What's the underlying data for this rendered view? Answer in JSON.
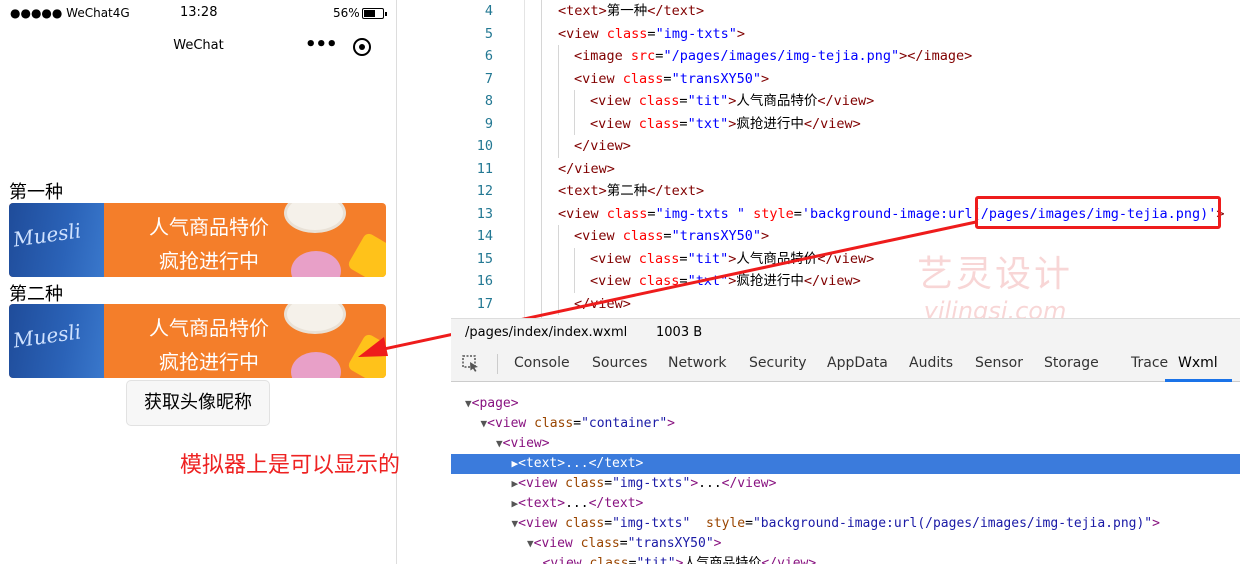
{
  "status_bar": {
    "signal": "●●●●● WeChat4G",
    "time": "13:28",
    "battery": "56%"
  },
  "navbar": {
    "title": "WeChat",
    "menu_dots": "•••"
  },
  "content": {
    "item1": {
      "label": "第一种",
      "tit": "人气商品特价",
      "txt": "疯抢进行中"
    },
    "item2": {
      "label": "第二种",
      "tit": "人气商品特价",
      "txt": "疯抢进行中"
    },
    "button_label": "获取头像昵称"
  },
  "annotation": "模拟器上是可以显示的",
  "editor": {
    "lines": [
      {
        "num": "4",
        "indent": 0,
        "parts": [
          [
            "tag",
            "<text>"
          ],
          [
            "txt",
            "第一种"
          ],
          [
            "tag",
            "</text>"
          ]
        ]
      },
      {
        "num": "5",
        "indent": 0,
        "parts": [
          [
            "tag",
            "<view "
          ],
          [
            "attr",
            "class"
          ],
          [
            "txt",
            "="
          ],
          [
            "val",
            "\"img-txts\""
          ],
          [
            "tag",
            ">"
          ]
        ]
      },
      {
        "num": "6",
        "indent": 1,
        "parts": [
          [
            "tag",
            "<image "
          ],
          [
            "attr",
            "src"
          ],
          [
            "txt",
            "="
          ],
          [
            "val",
            "\"/pages/images/img-tejia.png\""
          ],
          [
            "tag",
            "></image>"
          ]
        ]
      },
      {
        "num": "7",
        "indent": 1,
        "parts": [
          [
            "tag",
            "<view "
          ],
          [
            "attr",
            "class"
          ],
          [
            "txt",
            "="
          ],
          [
            "val",
            "\"transXY50\""
          ],
          [
            "tag",
            ">"
          ]
        ]
      },
      {
        "num": "8",
        "indent": 2,
        "parts": [
          [
            "tag",
            "<view "
          ],
          [
            "attr",
            "class"
          ],
          [
            "txt",
            "="
          ],
          [
            "val",
            "\"tit\""
          ],
          [
            "tag",
            ">"
          ],
          [
            "txt",
            "人气商品特价"
          ],
          [
            "tag",
            "</view>"
          ]
        ]
      },
      {
        "num": "9",
        "indent": 2,
        "parts": [
          [
            "tag",
            "<view "
          ],
          [
            "attr",
            "class"
          ],
          [
            "txt",
            "="
          ],
          [
            "val",
            "\"txt\""
          ],
          [
            "tag",
            ">"
          ],
          [
            "txt",
            "疯抢进行中"
          ],
          [
            "tag",
            "</view>"
          ]
        ]
      },
      {
        "num": "10",
        "indent": 1,
        "parts": [
          [
            "tag",
            "</view>"
          ]
        ]
      },
      {
        "num": "11",
        "indent": 0,
        "parts": [
          [
            "tag",
            "</view>"
          ]
        ]
      },
      {
        "num": "12",
        "indent": 0,
        "parts": [
          [
            "tag",
            "<text>"
          ],
          [
            "txt",
            "第二种"
          ],
          [
            "tag",
            "</text>"
          ]
        ]
      },
      {
        "num": "13",
        "indent": 0,
        "parts": [
          [
            "tag",
            "<view "
          ],
          [
            "attr",
            "class"
          ],
          [
            "txt",
            "="
          ],
          [
            "val",
            "\"img-txts \""
          ],
          [
            "attr",
            " style"
          ],
          [
            "txt",
            "="
          ],
          [
            "val",
            "'background-image:url(/pages/images/img-tejia.png)'"
          ],
          [
            "tag",
            ">"
          ]
        ]
      },
      {
        "num": "14",
        "indent": 1,
        "parts": [
          [
            "tag",
            "<view "
          ],
          [
            "attr",
            "class"
          ],
          [
            "txt",
            "="
          ],
          [
            "val",
            "\"transXY50\""
          ],
          [
            "tag",
            ">"
          ]
        ]
      },
      {
        "num": "15",
        "indent": 2,
        "parts": [
          [
            "tag",
            "<view "
          ],
          [
            "attr",
            "class"
          ],
          [
            "txt",
            "="
          ],
          [
            "val",
            "\"tit\""
          ],
          [
            "tag",
            ">"
          ],
          [
            "txt",
            "人气商品特价"
          ],
          [
            "tag",
            "</view>"
          ]
        ]
      },
      {
        "num": "16",
        "indent": 2,
        "parts": [
          [
            "tag",
            "<view "
          ],
          [
            "attr",
            "class"
          ],
          [
            "txt",
            "="
          ],
          [
            "val",
            "\"txt\""
          ],
          [
            "tag",
            ">"
          ],
          [
            "txt",
            "疯抢进行中"
          ],
          [
            "tag",
            "</view>"
          ]
        ]
      },
      {
        "num": "17",
        "indent": 1,
        "parts": [
          [
            "tag",
            "</view>"
          ]
        ]
      }
    ]
  },
  "watermark": {
    "cn": "艺灵设计",
    "en": "yilingsj.com"
  },
  "file_bar": {
    "path": "/pages/index/index.wxml",
    "size": "1003 B"
  },
  "devtools_tabs": [
    "Console",
    "Sources",
    "Network",
    "Security",
    "AppData",
    "Audits",
    "Sensor",
    "Storage",
    "Trace",
    "Wxml"
  ],
  "active_tab": "Wxml",
  "dom_tree": [
    {
      "indent": 0,
      "tri": "▼",
      "parts": [
        [
          "tag",
          "<page>"
        ]
      ],
      "selected": false
    },
    {
      "indent": 1,
      "tri": "▼",
      "parts": [
        [
          "tag",
          "<view "
        ],
        [
          "attr",
          "class"
        ],
        [
          "txt",
          "="
        ],
        [
          "val",
          "\"container\""
        ],
        [
          "tag",
          ">"
        ]
      ],
      "selected": false
    },
    {
      "indent": 2,
      "tri": "▼",
      "parts": [
        [
          "tag",
          "<view>"
        ]
      ],
      "selected": false
    },
    {
      "indent": 3,
      "tri": "▶",
      "parts": [
        [
          "tag",
          "<text>"
        ],
        [
          "txt",
          "..."
        ],
        [
          "tag",
          "</text>"
        ]
      ],
      "selected": true
    },
    {
      "indent": 3,
      "tri": "▶",
      "parts": [
        [
          "tag",
          "<view "
        ],
        [
          "attr",
          "class"
        ],
        [
          "txt",
          "="
        ],
        [
          "val",
          "\"img-txts\""
        ],
        [
          "tag",
          ">"
        ],
        [
          "txt",
          "..."
        ],
        [
          "tag",
          "</view>"
        ]
      ],
      "selected": false
    },
    {
      "indent": 3,
      "tri": "▶",
      "parts": [
        [
          "tag",
          "<text>"
        ],
        [
          "txt",
          "..."
        ],
        [
          "tag",
          "</text>"
        ]
      ],
      "selected": false
    },
    {
      "indent": 3,
      "tri": "▼",
      "parts": [
        [
          "tag",
          "<view "
        ],
        [
          "attr",
          "class"
        ],
        [
          "txt",
          "="
        ],
        [
          "val",
          "\"img-txts\""
        ],
        [
          "attr",
          "  style"
        ],
        [
          "txt",
          "="
        ],
        [
          "val",
          "\"background-image:url(/pages/images/img-tejia.png)\""
        ],
        [
          "tag",
          ">"
        ]
      ],
      "selected": false
    },
    {
      "indent": 4,
      "tri": "▼",
      "parts": [
        [
          "tag",
          "<view "
        ],
        [
          "attr",
          "class"
        ],
        [
          "txt",
          "="
        ],
        [
          "val",
          "\"transXY50\""
        ],
        [
          "tag",
          ">"
        ]
      ],
      "selected": false
    },
    {
      "indent": 5,
      "tri": "",
      "parts": [
        [
          "tag",
          "<view "
        ],
        [
          "attr",
          "class"
        ],
        [
          "txt",
          "="
        ],
        [
          "val",
          "\"tit\""
        ],
        [
          "tag",
          ">"
        ],
        [
          "txt",
          "人气商品特价"
        ],
        [
          "tag",
          "</view>"
        ]
      ],
      "selected": false
    }
  ],
  "colors": {
    "accent_blue": "#3b7bdc",
    "highlight_red": "#ee1c1c",
    "banner_orange": "#f47e2a"
  }
}
